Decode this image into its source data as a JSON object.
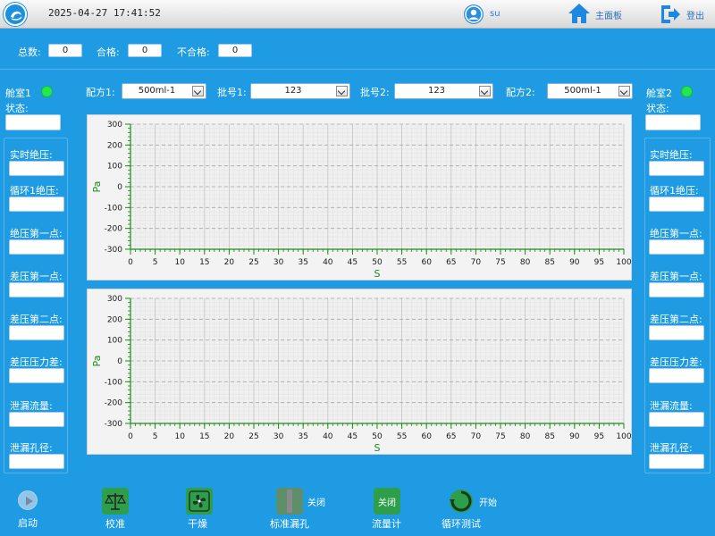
{
  "header": {
    "datetime": "2025-04-27 17:41:52",
    "user": "su",
    "home_label": "主面板",
    "logout_label": "登出"
  },
  "counts": {
    "total_label": "总数:",
    "total_value": "0",
    "pass_label": "合格:",
    "pass_value": "0",
    "fail_label": "不合格:",
    "fail_value": "0"
  },
  "chambers": [
    {
      "title": "舱室1",
      "status_label": "状态:",
      "status_color": "#22e84b",
      "fields": [
        "实时绝压:",
        "循环1绝压:",
        "绝压第一点:",
        "差压第一点:",
        "差压第二点:",
        "差压压力差:",
        "泄漏流量:",
        "泄漏孔径:"
      ]
    },
    {
      "title": "舱室2",
      "status_label": "状态:",
      "status_color": "#22e84b",
      "fields": [
        "实时绝压:",
        "循环1绝压:",
        "绝压第一点:",
        "差压第一点:",
        "差压第二点:",
        "差压压力差:",
        "泄漏流量:",
        "泄漏孔径:"
      ]
    }
  ],
  "selectors": {
    "recipe1_label": "配方1:",
    "recipe1_value": "500ml-1",
    "batch1_label": "批号1:",
    "batch1_value": "123",
    "batch2_label": "批号2:",
    "batch2_value": "123",
    "recipe2_label": "配方2:",
    "recipe2_value": "500ml-1"
  },
  "chart_data": [
    {
      "type": "line",
      "title": "",
      "xlabel": "S",
      "ylabel": "Pa",
      "xlim": [
        0,
        100
      ],
      "ylim": [
        -300,
        300
      ],
      "x_ticks": [
        0,
        5,
        10,
        15,
        20,
        25,
        30,
        35,
        40,
        45,
        50,
        55,
        60,
        65,
        70,
        75,
        80,
        85,
        90,
        95,
        100
      ],
      "y_ticks": [
        300,
        200,
        100,
        0,
        -100,
        -200,
        -300
      ],
      "grid": true,
      "series": []
    },
    {
      "type": "line",
      "title": "",
      "xlabel": "S",
      "ylabel": "Pa",
      "xlim": [
        0,
        100
      ],
      "ylim": [
        -300,
        300
      ],
      "x_ticks": [
        0,
        5,
        10,
        15,
        20,
        25,
        30,
        35,
        40,
        45,
        50,
        55,
        60,
        65,
        70,
        75,
        80,
        85,
        90,
        95,
        100
      ],
      "y_ticks": [
        300,
        200,
        100,
        0,
        -100,
        -200,
        -300
      ],
      "grid": true,
      "series": []
    }
  ],
  "toolbar": {
    "start_label": "启动",
    "calibrate_label": "校准",
    "dry_label": "干燥",
    "std_leak_label": "标准漏孔",
    "std_leak_state": "关闭",
    "flowmeter_label": "流量计",
    "flowmeter_state": "关闭",
    "cycle_label": "循环测试",
    "cycle_state": "开始"
  },
  "colors": {
    "background": "#1e9be2",
    "status_ok": "#22e84b",
    "chart_axis": "#1a8a1a",
    "toolbar_green": "#2e9e4a"
  }
}
